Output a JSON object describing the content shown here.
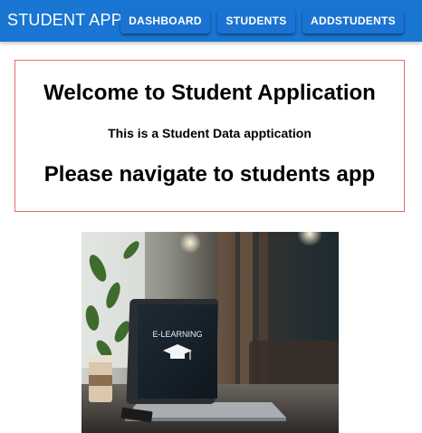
{
  "appbar": {
    "brand": "STUDENT APP",
    "nav": [
      {
        "label": "DASHBOARD"
      },
      {
        "label": "STUDENTS"
      },
      {
        "label": "ADDSTUDENTS"
      }
    ],
    "color": "#1976d2"
  },
  "welcome": {
    "title": "Welcome to Student Application",
    "subtitle": "This is a Student Data apptication",
    "cta": "Please navigate to students app",
    "border_color": "#e06c6c"
  },
  "hero_image": {
    "laptop_screen_text": "E-LEARNING",
    "icon": "graduation-cap-icon"
  }
}
